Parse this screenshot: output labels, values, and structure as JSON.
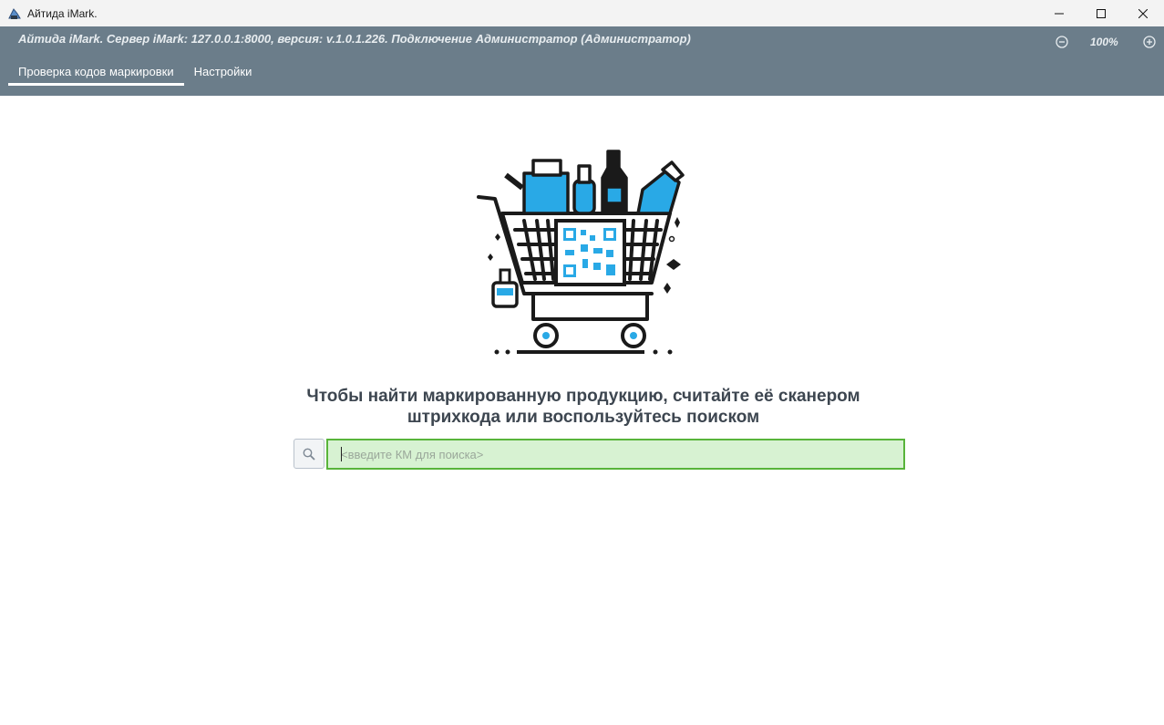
{
  "window": {
    "title": "Айтида iMark."
  },
  "header": {
    "status": "Айтида iMark. Сервер iMark: 127.0.0.1:8000, версия: v.1.0.1.226. Подключение Администратор (Администратор)",
    "zoom": "100%",
    "tabs": [
      {
        "label": "Проверка кодов маркировки",
        "active": true
      },
      {
        "label": "Настройки",
        "active": false
      }
    ]
  },
  "main": {
    "heading_line1": "Чтобы найти маркированную продукцию, считайте её сканером",
    "heading_line2": "штрихкода или воспользуйтесь поиском",
    "search_placeholder": "<введите КМ для поиска>"
  },
  "colors": {
    "header_bg": "#6b7d8a",
    "input_bg": "#d7f2d2",
    "input_border": "#58b43a",
    "accent_blue": "#29a9e6"
  },
  "icons": [
    "app-icon",
    "minimize-icon",
    "maximize-icon",
    "close-icon",
    "zoom-out-icon",
    "zoom-in-icon",
    "search-icon",
    "shopping-cart-illustration"
  ]
}
